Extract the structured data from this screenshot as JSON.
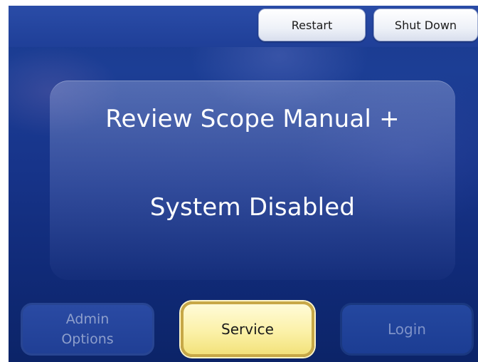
{
  "top_bar": {
    "restart_label": "Restart",
    "shutdown_label": "Shut Down"
  },
  "message": {
    "line1": "Review Scope Manual +",
    "line2": "System Disabled"
  },
  "bottom_bar": {
    "admin_options_line1": "Admin",
    "admin_options_line2": "Options",
    "service_label": "Service",
    "login_label": "Login"
  },
  "colors": {
    "background_blue": "#17348a",
    "service_highlight": "#fbf1a8",
    "service_border": "#c7a847",
    "disabled_text": "#8e9fcc"
  }
}
